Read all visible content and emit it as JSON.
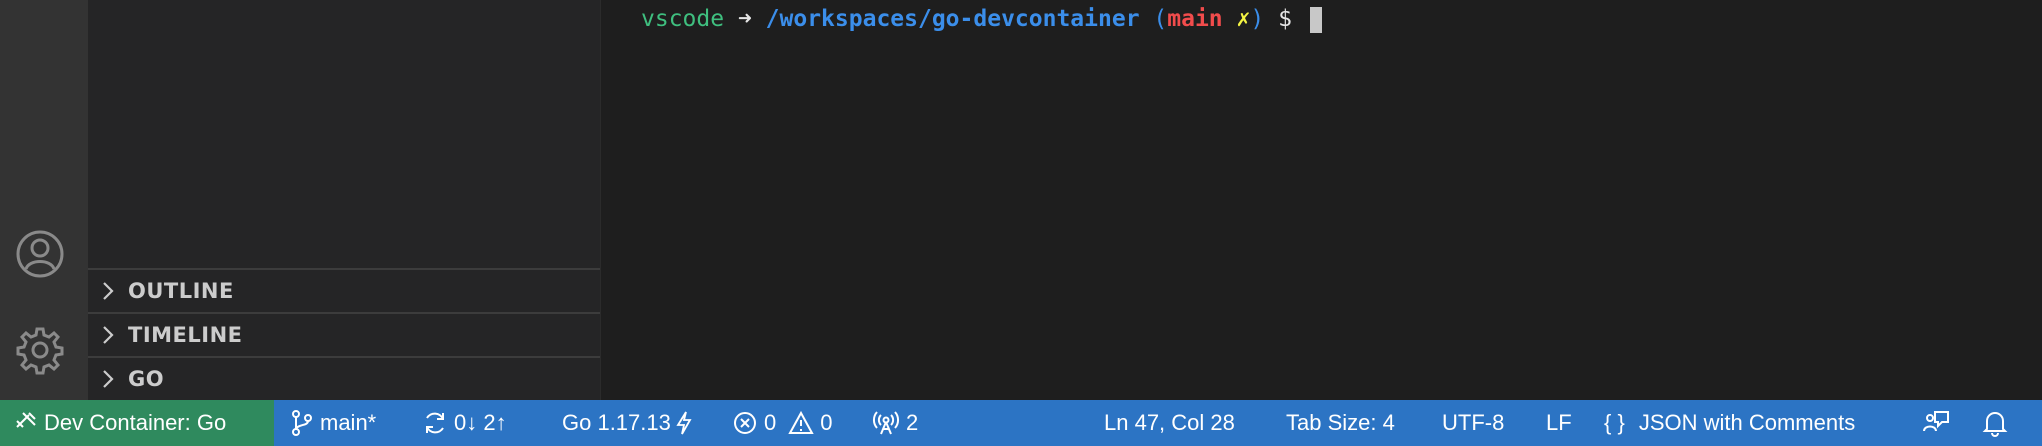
{
  "activity_bar": {
    "icons": [
      "account-icon",
      "gear-icon"
    ]
  },
  "sidebar": {
    "sections": [
      {
        "label": "OUTLINE"
      },
      {
        "label": "TIMELINE"
      },
      {
        "label": "GO"
      }
    ]
  },
  "terminal": {
    "user": "vscode",
    "arrow": "➜",
    "path": "/workspaces/go-devcontainer",
    "paren_open": "(",
    "branch": "main",
    "dirty": "✗",
    "paren_close": ")",
    "dollar": "$"
  },
  "statusbar": {
    "remote": "Dev Container: Go",
    "branch": "main*",
    "sync": "0↓ 2↑",
    "go_version": "Go 1.17.13",
    "errors": "0",
    "warnings": "0",
    "ports": "2",
    "position": "Ln 47, Col 28",
    "tab_size": "Tab Size: 4",
    "encoding": "UTF-8",
    "eol": "LF",
    "language_braces": "{ }",
    "language": "JSON with Comments",
    "colors": {
      "background": "#2c74c4",
      "remote": "#2f8a5e"
    }
  }
}
